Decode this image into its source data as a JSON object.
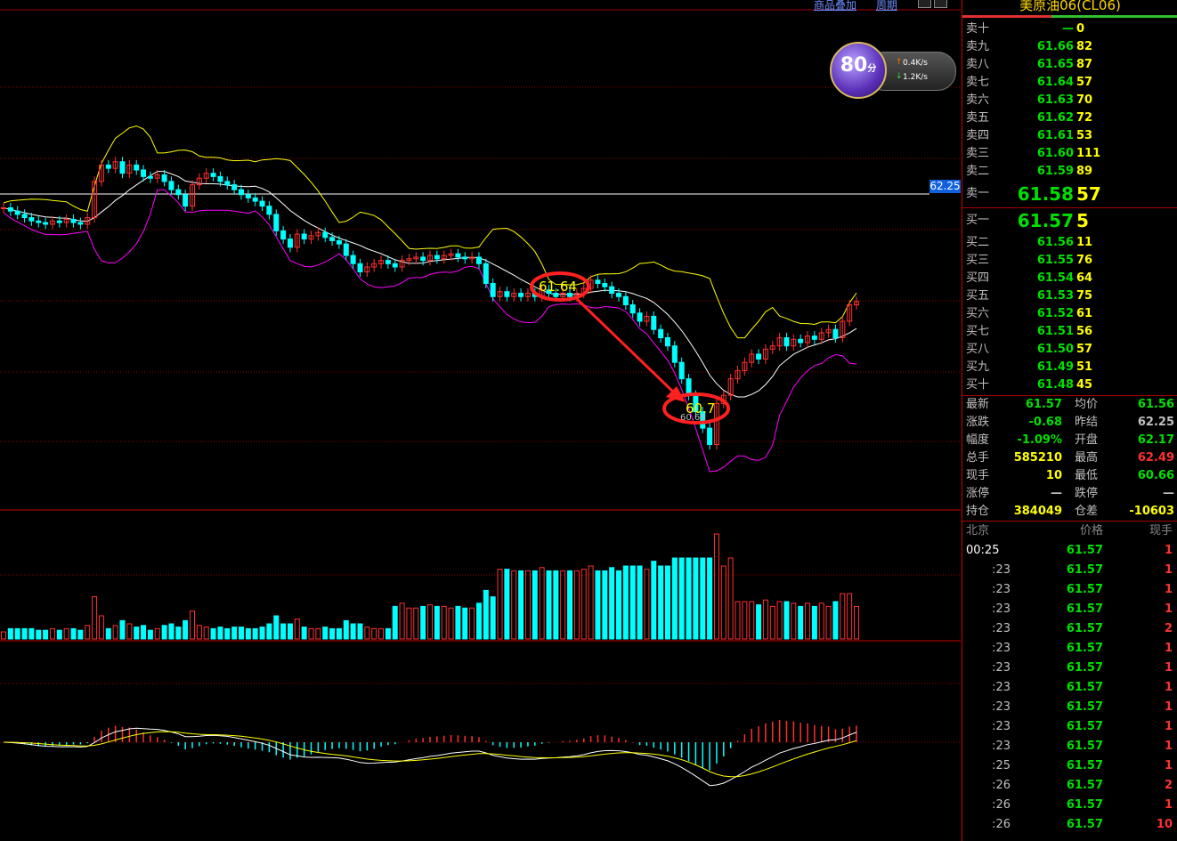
{
  "toolbar": {
    "link1": "商品叠加",
    "link2": "周期"
  },
  "panel": {
    "title": "美原油06(CL06)",
    "asks": [
      {
        "label": "卖十",
        "price": "—",
        "vol": "0"
      },
      {
        "label": "卖九",
        "price": "61.66",
        "vol": "82"
      },
      {
        "label": "卖八",
        "price": "61.65",
        "vol": "87"
      },
      {
        "label": "卖七",
        "price": "61.64",
        "vol": "57"
      },
      {
        "label": "卖六",
        "price": "61.63",
        "vol": "70"
      },
      {
        "label": "卖五",
        "price": "61.62",
        "vol": "72"
      },
      {
        "label": "卖四",
        "price": "61.61",
        "vol": "53"
      },
      {
        "label": "卖三",
        "price": "61.60",
        "vol": "111"
      },
      {
        "label": "卖二",
        "price": "61.59",
        "vol": "89"
      },
      {
        "label": "卖一",
        "price": "61.58",
        "vol": "57"
      }
    ],
    "bids": [
      {
        "label": "买一",
        "price": "61.57",
        "vol": "5"
      },
      {
        "label": "买二",
        "price": "61.56",
        "vol": "11"
      },
      {
        "label": "买三",
        "price": "61.55",
        "vol": "76"
      },
      {
        "label": "买四",
        "price": "61.54",
        "vol": "64"
      },
      {
        "label": "买五",
        "price": "61.53",
        "vol": "75"
      },
      {
        "label": "买六",
        "price": "61.52",
        "vol": "61"
      },
      {
        "label": "买七",
        "price": "61.51",
        "vol": "56"
      },
      {
        "label": "买八",
        "price": "61.50",
        "vol": "57"
      },
      {
        "label": "买九",
        "price": "61.49",
        "vol": "51"
      },
      {
        "label": "买十",
        "price": "61.48",
        "vol": "45"
      }
    ],
    "quote": [
      {
        "l1": "最新",
        "v1": "61.57",
        "c1": "#00e000",
        "l2": "均价",
        "v2": "61.56",
        "c2": "#00e000"
      },
      {
        "l1": "涨跌",
        "v1": "-0.68",
        "c1": "#00e000",
        "l2": "昨结",
        "v2": "62.25",
        "c2": "#c0c0c0"
      },
      {
        "l1": "幅度",
        "v1": "-1.09%",
        "c1": "#00e000",
        "l2": "开盘",
        "v2": "62.17",
        "c2": "#00e000"
      },
      {
        "l1": "总手",
        "v1": "585210",
        "c1": "#ffff00",
        "l2": "最高",
        "v2": "62.49",
        "c2": "#ff3030"
      },
      {
        "l1": "现手",
        "v1": "10",
        "c1": "#ffff00",
        "l2": "最低",
        "v2": "60.66",
        "c2": "#00e000"
      },
      {
        "l1": "涨停",
        "v1": "—",
        "c1": "#c0c0c0",
        "l2": "跌停",
        "v2": "—",
        "c2": "#c0c0c0"
      },
      {
        "l1": "持仓",
        "v1": "384049",
        "c1": "#ffff00",
        "l2": "仓差",
        "v2": "-10603",
        "c2": "#ffff00"
      }
    ],
    "ticks_header": {
      "time": "北京",
      "price": "价格",
      "vol": "现手"
    },
    "ticks": [
      {
        "t": "00:25",
        "p": "61.57",
        "v": "1"
      },
      {
        "t": ":23",
        "p": "61.57",
        "v": "1"
      },
      {
        "t": ":23",
        "p": "61.57",
        "v": "1"
      },
      {
        "t": ":23",
        "p": "61.57",
        "v": "1"
      },
      {
        "t": ":23",
        "p": "61.57",
        "v": "2"
      },
      {
        "t": ":23",
        "p": "61.57",
        "v": "1"
      },
      {
        "t": ":23",
        "p": "61.57",
        "v": "1"
      },
      {
        "t": ":23",
        "p": "61.57",
        "v": "1"
      },
      {
        "t": ":23",
        "p": "61.57",
        "v": "1"
      },
      {
        "t": ":23",
        "p": "61.57",
        "v": "1"
      },
      {
        "t": ":23",
        "p": "61.57",
        "v": "1"
      },
      {
        "t": ":25",
        "p": "61.57",
        "v": "1"
      },
      {
        "t": ":26",
        "p": "61.57",
        "v": "2"
      },
      {
        "t": ":26",
        "p": "61.57",
        "v": "1"
      },
      {
        "t": ":26",
        "p": "61.57",
        "v": "10"
      }
    ]
  },
  "speed": {
    "score": "80",
    "unit": "分",
    "up_rate": "0.4K/s",
    "down_rate": "1.2K/s"
  },
  "chart": {
    "prev_settle_label": "62.25",
    "annotation_high": "61.64",
    "annotation_low": "60.7",
    "annotation_low2": "60.66",
    "colors": {
      "up": "#ff3030",
      "down": "#00ffff",
      "ma": "#ffffff",
      "upper": "#ffff00",
      "lower": "#ff00ff",
      "grid": "#8b0000",
      "marker": "#ff2020"
    }
  },
  "chart_data": {
    "type": "candlestick",
    "title": "",
    "prev_settle": 62.25,
    "candles_close": [
      62.14,
      62.12,
      62.1,
      62.08,
      62.06,
      62.05,
      62.04,
      62.06,
      62.05,
      62.07,
      62.05,
      62.04,
      62.08,
      62.3,
      62.4,
      62.38,
      62.42,
      62.35,
      62.4,
      62.37,
      62.33,
      62.32,
      62.34,
      62.3,
      62.25,
      62.22,
      62.15,
      62.28,
      62.32,
      62.35,
      62.33,
      62.3,
      62.28,
      62.25,
      62.22,
      62.2,
      62.18,
      62.15,
      62.1,
      62.0,
      61.95,
      61.9,
      61.98,
      61.95,
      61.97,
      61.99,
      61.96,
      61.94,
      61.92,
      61.85,
      61.8,
      61.75,
      61.78,
      61.8,
      61.82,
      61.8,
      61.78,
      61.82,
      61.83,
      61.84,
      61.82,
      61.85,
      61.83,
      61.85,
      61.86,
      61.84,
      61.83,
      61.84,
      61.8,
      61.68,
      61.6,
      61.63,
      61.6,
      61.62,
      61.6,
      61.62,
      61.6,
      61.64,
      61.62,
      61.6,
      61.62,
      61.6,
      61.62,
      61.65,
      61.7,
      61.68,
      61.66,
      61.62,
      61.6,
      61.55,
      61.5,
      61.45,
      61.48,
      61.4,
      61.35,
      61.3,
      61.2,
      61.1,
      61.0,
      60.9,
      60.8,
      60.7,
      60.95,
      61.0,
      61.1,
      61.15,
      61.2,
      61.25,
      61.22,
      61.28,
      61.3,
      61.35,
      61.3,
      61.34,
      61.32,
      61.36,
      61.34,
      61.38,
      61.4,
      61.35,
      61.45,
      61.55,
      61.57
    ],
    "volume_note": "volume bars and MACD histogram beneath price pane"
  }
}
